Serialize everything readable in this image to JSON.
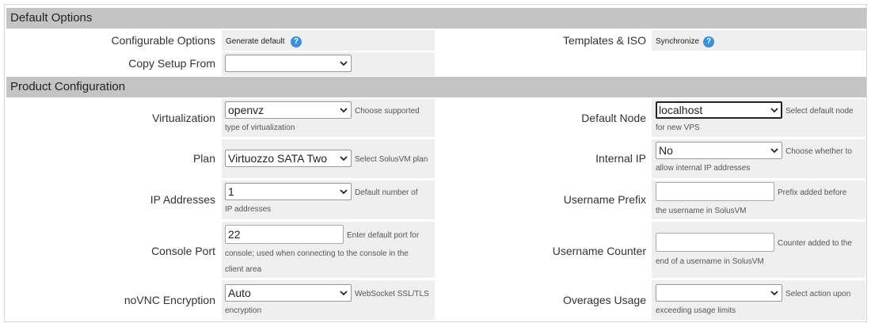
{
  "default_options": {
    "title": "Default Options",
    "configurable_options": {
      "label": "Configurable Options",
      "action": "Generate default"
    },
    "templates_iso": {
      "label": "Templates & ISO",
      "action": "Synchronize"
    },
    "copy_setup": {
      "label": "Copy Setup From",
      "value": ""
    }
  },
  "product_configuration": {
    "title": "Product Configuration",
    "virtualization": {
      "label": "Virtualization",
      "value": "openvz",
      "hint1": "Choose supported",
      "hint2": "type of virtualization"
    },
    "plan": {
      "label": "Plan",
      "value": "Virtuozzo SATA Two",
      "hint1": "Select SolusVM plan"
    },
    "ip_addresses": {
      "label": "IP Addresses",
      "value": "1",
      "hint1": "Default number of",
      "hint2": "IP addresses"
    },
    "console_port": {
      "label": "Console Port",
      "value": "22",
      "hint1": "Enter default port for",
      "hint2": "console; used when connecting to the console in the",
      "hint3": "client area"
    },
    "novnc": {
      "label": "noVNC Encryption",
      "value": "Auto",
      "hint1": "WebSocket SSL/TLS",
      "hint2": "encryption"
    },
    "default_node": {
      "label": "Default Node",
      "value": "localhost",
      "hint1": "Select default node",
      "hint2": "for new VPS"
    },
    "internal_ip": {
      "label": "Internal IP",
      "value": "No",
      "hint1": "Choose whether to",
      "hint2": "allow internal IP addresses"
    },
    "username_prefix": {
      "label": "Username Prefix",
      "value": "",
      "hint1": "Prefix added before",
      "hint2": "the username in SolusVM"
    },
    "username_counter": {
      "label": "Username Counter",
      "value": "",
      "hint1": "Counter added to the",
      "hint2": "end of a username in SolusVM"
    },
    "overages": {
      "label": "Overages Usage",
      "value": "",
      "hint1": "Select action upon",
      "hint2": "exceeding usage limits"
    }
  },
  "icons": {
    "help": "?"
  },
  "colors": {
    "section_bg": "#c4c4c4",
    "cell_bg": "#efefef",
    "help_icon": "#3f8fd8"
  }
}
